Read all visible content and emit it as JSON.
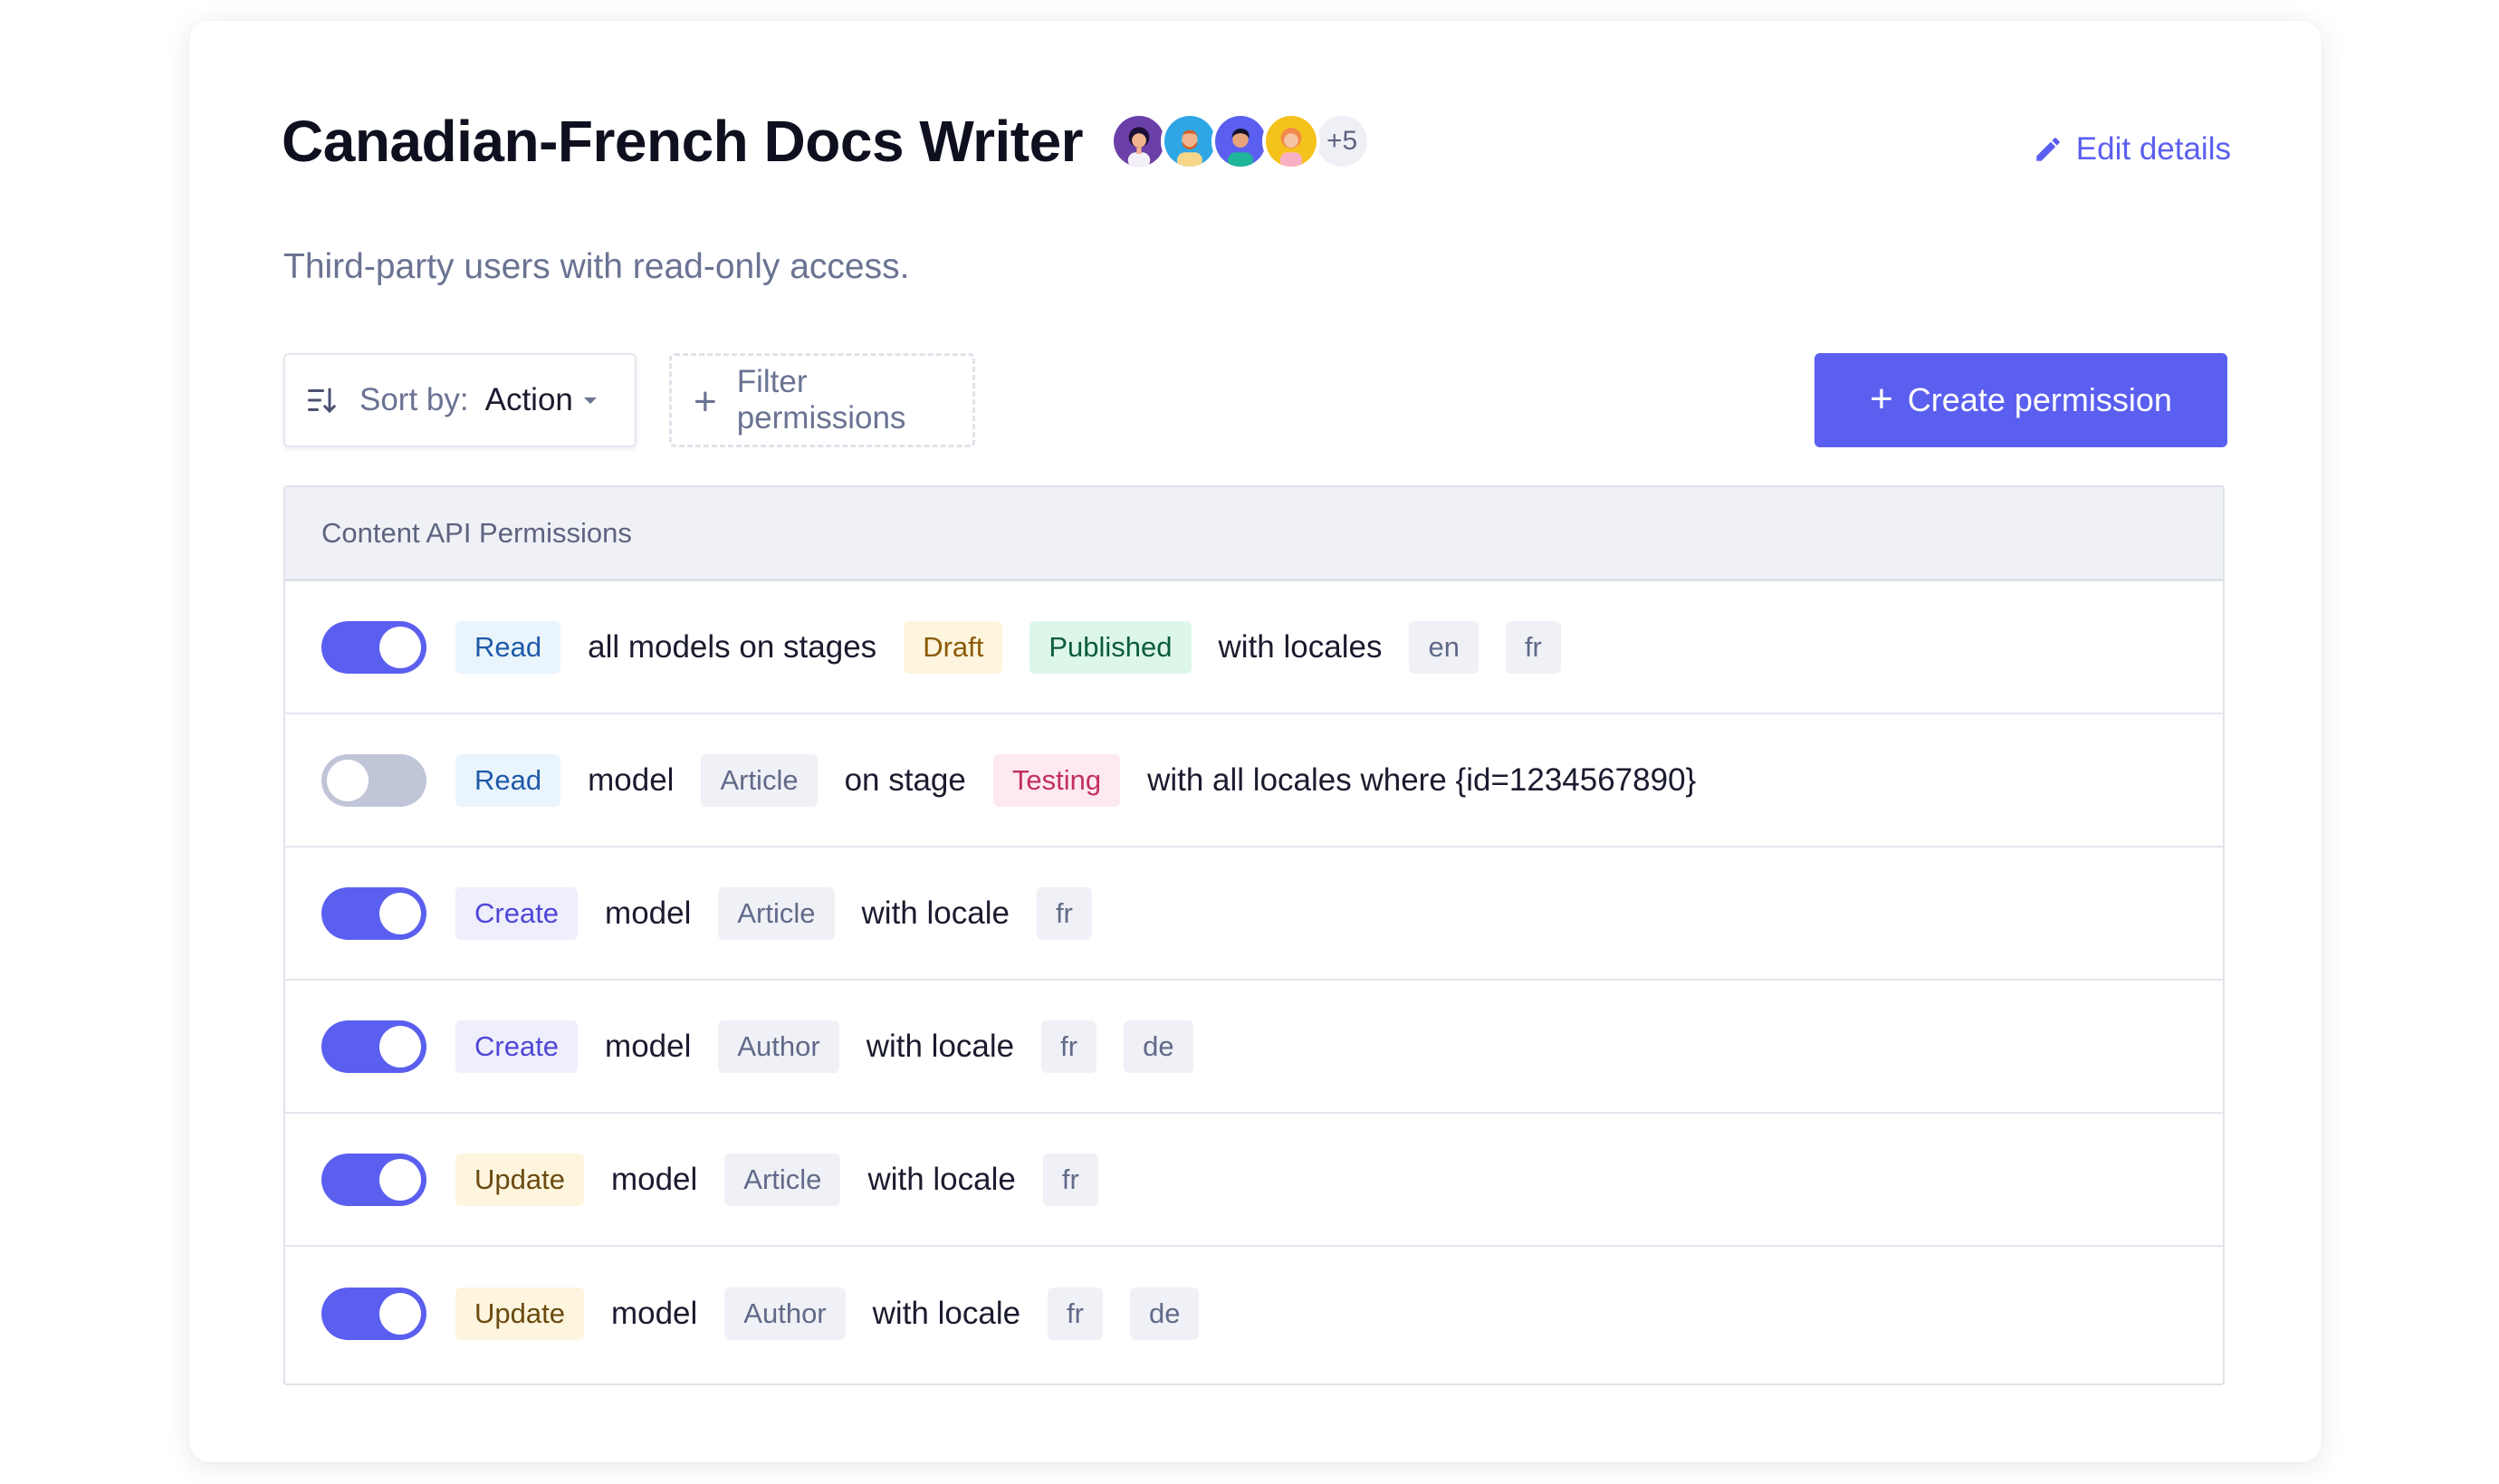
{
  "header": {
    "title": "Canadian-French Docs Writer",
    "avatars_more": "+5",
    "edit_label": "Edit details",
    "subtitle": "Third-party users with read-only access."
  },
  "toolbar": {
    "sort_label": "Sort by:",
    "sort_value": "Action",
    "filter_label": "Filter permissions",
    "create_label": "Create permission"
  },
  "colors": {
    "accent": "#5b5fef",
    "toggle_off": "#c0c6d8"
  },
  "table": {
    "header": "Content API Permissions",
    "rows": [
      {
        "enabled": true,
        "action": "Read",
        "text1": "all models on stages",
        "stages": [
          "Draft",
          "Published"
        ],
        "text2": "with locales",
        "locales": [
          "en",
          "fr"
        ]
      },
      {
        "enabled": false,
        "action": "Read",
        "text1": "model",
        "model": "Article",
        "text2": "on stage",
        "stage": "Testing",
        "text3": "with all locales where {id=1234567890}"
      },
      {
        "enabled": true,
        "action": "Create",
        "text1": "model",
        "model": "Article",
        "text2": "with locale",
        "locales": [
          "fr"
        ]
      },
      {
        "enabled": true,
        "action": "Create",
        "text1": "model",
        "model": "Author",
        "text2": "with locale",
        "locales": [
          "fr",
          "de"
        ]
      },
      {
        "enabled": true,
        "action": "Update",
        "text1": "model",
        "model": "Article",
        "text2": "with locale",
        "locales": [
          "fr"
        ]
      },
      {
        "enabled": true,
        "action": "Update",
        "text1": "model",
        "model": "Author",
        "text2": "with locale",
        "locales": [
          "fr",
          "de"
        ]
      }
    ]
  }
}
